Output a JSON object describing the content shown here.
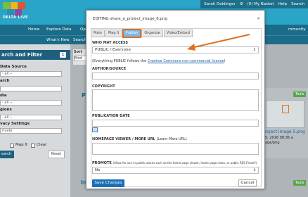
{
  "brand": {
    "logo_text": "DELTA LIVE"
  },
  "topbar": {
    "user": "Sarah Doldinger",
    "basket": "(0) My Basket",
    "help": "Help",
    "search_label": "Search"
  },
  "nav1": [
    "Home",
    "Explore Data",
    "Op",
    "mmunity"
  ],
  "nav2": [
    "What's New",
    "Search D"
  ],
  "sidebar": {
    "title": "arch and Filter",
    "badge": "1",
    "labels": [
      "Data Source",
      "arch",
      "dia",
      "gions",
      "vacy Settings"
    ],
    "selects": [
      "- all --",
      "- all --",
      "- all --",
      "rivate"
    ],
    "map_it": "Map It",
    "clear": "Clear",
    "search_btn": "earch",
    "reset_btn": "Reset"
  },
  "main": {
    "sort_label": "Sort",
    "sort_value": "Mod",
    "letter_p": "P",
    "letter_in": "In",
    "tools": "Tools",
    "card_title": "roject image 5.png",
    "card_date": "5, 2016 08:36 a",
    "card_type": "age/png"
  },
  "modal": {
    "title": "EDITING share_a_project_image_6.png",
    "close": "×",
    "tabs": [
      "Main",
      "Map It",
      "Publish",
      "Organize",
      "Video/Embed"
    ],
    "active_tab": "Publish",
    "who_label": "WHO MAY ACCESS",
    "who_value": "PUBLIC / Everyone",
    "license_prefix": "(Everything PUBLIC follows the ",
    "license_link": "Creative Commons non-commercial license",
    "license_suffix": ")",
    "author_label": "AUTHOR/SOURCE",
    "copyright_label": "COPYRIGHT",
    "pubdate_label": "PUBLICATION DATE",
    "homepage_label": "HOMEPAGE VIEWER / MORE URL",
    "homepage_hint": "(Learn More URL)",
    "promote_label": "PROMOTE",
    "promote_hint": "(Allow for use in public places such as the home page viewer, home page news, or public RSS Feeds?)",
    "promote_value": "No",
    "save": "Save Changes",
    "cancel": "Cancel"
  },
  "colors": {
    "accent": "#1a6fb8",
    "highlight": "#e07020",
    "header": "#2aa5c8",
    "nav": "#1b6c88"
  }
}
